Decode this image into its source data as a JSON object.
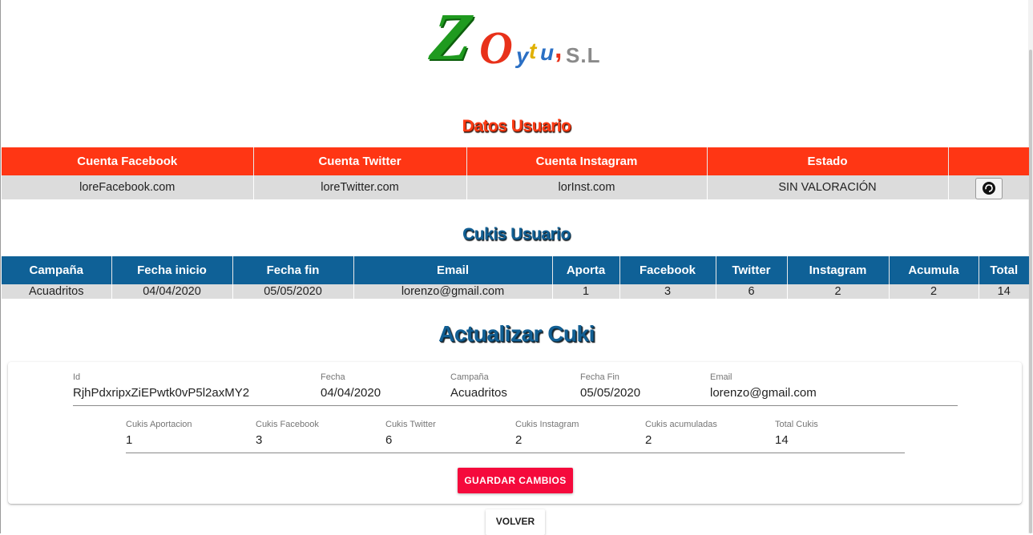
{
  "logo": {
    "z": "Z",
    "o": "O",
    "y": "y",
    "t": "t",
    "u": "u",
    "comma": ",",
    "sl": "S.L"
  },
  "user_section": {
    "title": "Datos Usuario",
    "headers": [
      "Cuenta Facebook",
      "Cuenta Twitter",
      "Cuenta Instagram",
      "Estado",
      ""
    ],
    "row": {
      "facebook": "loreFacebook.com",
      "twitter": "loreTwitter.com",
      "instagram": "lorInst.com",
      "estado": "SIN VALORACIÓN"
    },
    "refresh_icon": "refresh-icon"
  },
  "cukis_section": {
    "title": "Cukis Usuario",
    "headers": [
      "Campaña",
      "Fecha inicio",
      "Fecha fin",
      "Email",
      "Aporta",
      "Facebook",
      "Twitter",
      "Instagram",
      "Acumula",
      "Total"
    ],
    "row": [
      "Acuadritos",
      "04/04/2020",
      "05/05/2020",
      "lorenzo@gmail.com",
      "1",
      "3",
      "6",
      "2",
      "2",
      "14"
    ]
  },
  "update_section": {
    "title": "Actualizar Cuki",
    "row1": [
      {
        "label": "Id",
        "value": "RjhPdxripxZiEPwtk0vP5l2axMY2"
      },
      {
        "label": "Fecha",
        "value": "04/04/2020"
      },
      {
        "label": "Campaña",
        "value": "Acuadritos"
      },
      {
        "label": "Fecha Fin",
        "value": "05/05/2020"
      },
      {
        "label": "Email",
        "value": "lorenzo@gmail.com"
      }
    ],
    "row2": [
      {
        "label": "Cukis Aportacion",
        "value": "1"
      },
      {
        "label": "Cukis Facebook",
        "value": "3"
      },
      {
        "label": "Cukis Twitter",
        "value": "6"
      },
      {
        "label": "Cukis Instagram",
        "value": "2"
      },
      {
        "label": "Cukis acumuladas",
        "value": "2"
      },
      {
        "label": "Total Cukis",
        "value": "14"
      }
    ],
    "save_label": "GUARDAR CAMBIOS"
  },
  "back_label": "VOLVER",
  "colors": {
    "red_header": "#ff3614",
    "blue_header": "#0f6197",
    "save_button": "#f50a3c"
  }
}
